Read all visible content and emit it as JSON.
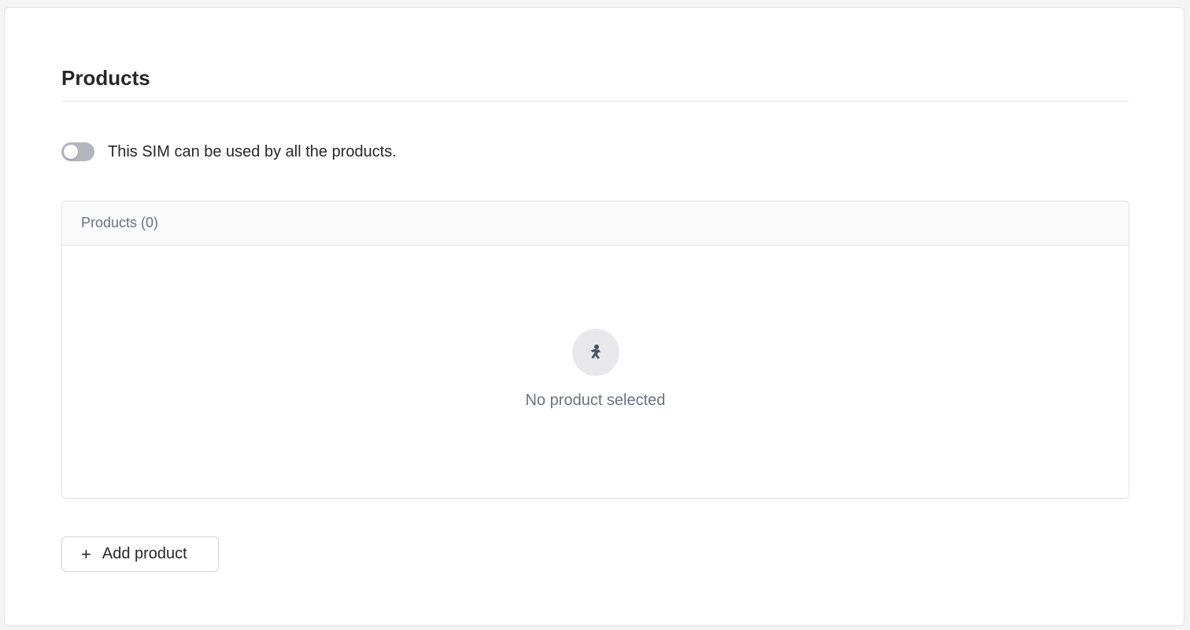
{
  "section": {
    "title": "Products"
  },
  "toggle": {
    "label": "This SIM can be used by all the products.",
    "checked": false
  },
  "products_panel": {
    "header": "Products (0)",
    "empty_icon": "person-icon",
    "empty_text": "No product selected"
  },
  "add_button": {
    "icon": "plus-icon",
    "label": "Add product"
  },
  "colors": {
    "toggle_off": "#b3b6bd",
    "muted_text": "#6b7280",
    "border": "#e4e4e7"
  }
}
